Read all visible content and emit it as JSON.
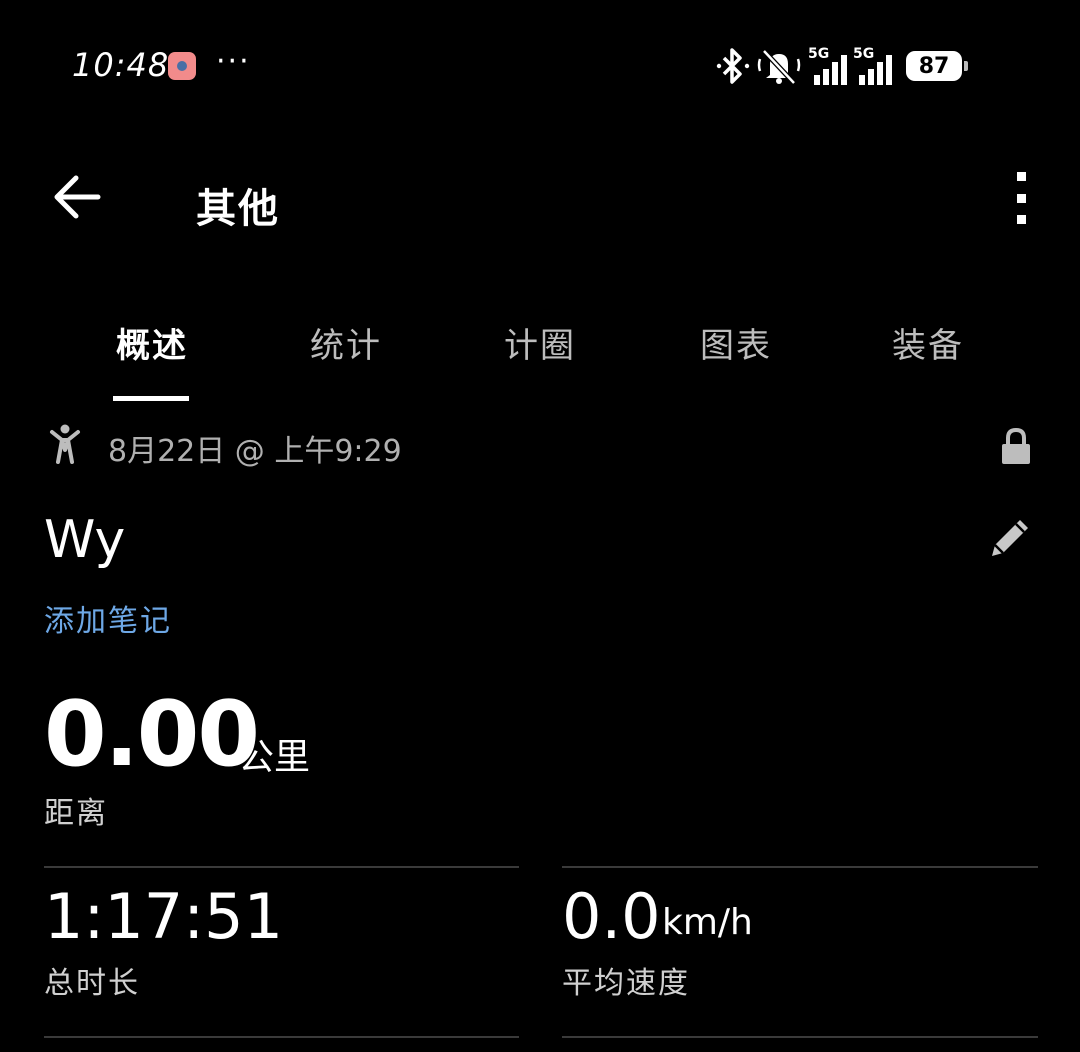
{
  "status_bar": {
    "time": "10:48",
    "more": "···",
    "network_1": "5G",
    "network_2": "5G",
    "battery": "87"
  },
  "header": {
    "title": "其他"
  },
  "tabs": [
    {
      "label": "概述",
      "active": true
    },
    {
      "label": "统计",
      "active": false
    },
    {
      "label": "计圈",
      "active": false
    },
    {
      "label": "图表",
      "active": false
    },
    {
      "label": "装备",
      "active": false
    }
  ],
  "activity": {
    "date": "8月22日 @ 上午9:29",
    "name": "Wy",
    "add_note": "添加笔记"
  },
  "distance": {
    "value": "0.00",
    "unit": "公里",
    "label": "距离"
  },
  "stats": {
    "duration": {
      "value": "1:17:51",
      "label": "总时长"
    },
    "avg_speed": {
      "value": "0.0",
      "unit": "km/h",
      "label": "平均速度"
    }
  },
  "icons": {
    "back": "arrow-left-icon",
    "menu": "kebab-menu-icon",
    "activity_type": "person-icon",
    "privacy": "lock-icon",
    "edit": "pencil-icon"
  },
  "colors": {
    "background": "#000000",
    "link": "#6ea8e6",
    "muted": "#b0b0b0"
  }
}
